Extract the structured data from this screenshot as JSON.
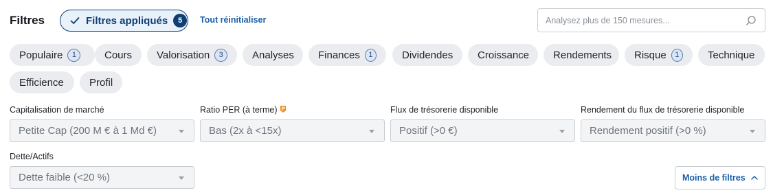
{
  "header": {
    "title": "Filtres",
    "applied_label": "Filtres appliqués",
    "applied_count": "5",
    "reset_label": "Tout réinitialiser",
    "search_placeholder": "Analysez plus de 150 mesures..."
  },
  "categories": [
    {
      "label": "Populaire",
      "badge": "1"
    },
    {
      "label": "Cours",
      "badge": ""
    },
    {
      "label": "Valorisation",
      "badge": "3"
    },
    {
      "label": "Analyses",
      "badge": ""
    },
    {
      "label": "Finances",
      "badge": "1"
    },
    {
      "label": "Dividendes",
      "badge": ""
    },
    {
      "label": "Croissance",
      "badge": ""
    },
    {
      "label": "Rendements",
      "badge": ""
    },
    {
      "label": "Risque",
      "badge": "1"
    },
    {
      "label": "Technique",
      "badge": ""
    },
    {
      "label": "Efficience",
      "badge": ""
    },
    {
      "label": "Profil",
      "badge": ""
    }
  ],
  "filters": [
    {
      "label": "Capitalisation de marché",
      "value": "Petite Cap (200 M € à 1 Md €)"
    },
    {
      "label": "Ratio PER (à terme)",
      "value": "Bas (2x à <15x)",
      "promo_icon": "pro-badge-icon"
    },
    {
      "label": "Flux de trésorerie disponible",
      "value": "Positif (>0 €)"
    },
    {
      "label": "Rendement du flux de trésorerie disponible",
      "value": "Rendement positif (>0 %)"
    },
    {
      "label": "Dette/Actifs",
      "value": "Dette faible (<20 %)"
    }
  ],
  "footer": {
    "less_filters_label": "Moins de filtres"
  },
  "colors": {
    "accent": "#0f3e73",
    "link": "#1b5fa8",
    "pill_bg": "#eaecef",
    "promo": "#f08c1a"
  }
}
